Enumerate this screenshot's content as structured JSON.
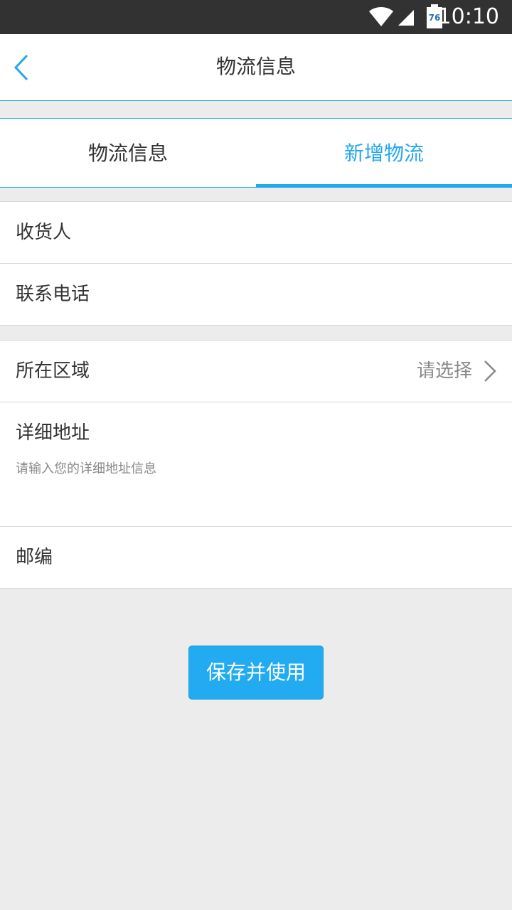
{
  "status_bar": {
    "time": "10:10",
    "battery_level": "76"
  },
  "header": {
    "title": "物流信息",
    "back_icon": "chevron-left-icon"
  },
  "tabs": [
    {
      "label": "物流信息",
      "active": false
    },
    {
      "label": "新增物流",
      "active": true
    }
  ],
  "form": {
    "recipient_label": "收货人",
    "phone_label": "联系电话",
    "region_label": "所在区域",
    "region_value": "请选择",
    "address_label": "详细地址",
    "address_placeholder": "请输入您的详细地址信息",
    "postcode_label": "邮编"
  },
  "actions": {
    "save_label": "保存并使用"
  },
  "colors": {
    "accent": "#23a7ee",
    "status_bar": "#323232",
    "background": "#ececec"
  }
}
